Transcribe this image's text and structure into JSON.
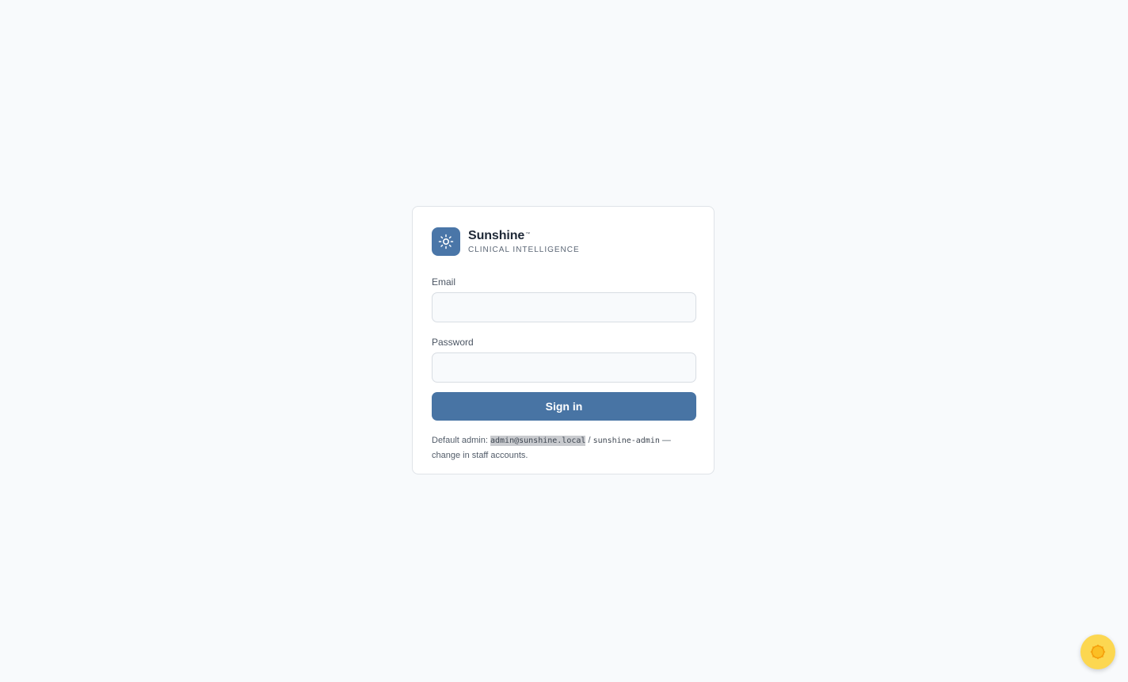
{
  "brand": {
    "logo_icon": "sun-icon",
    "name": "Sunshine",
    "trademark": "™",
    "tagline": "CLINICAL INTELLIGENCE"
  },
  "form": {
    "email_label": "Email",
    "email_value": "",
    "password_label": "Password",
    "password_value": "",
    "submit_label": "Sign in"
  },
  "hint": {
    "prefix": "Default admin: ",
    "email": "admin@sunshine.local",
    "separator": " / ",
    "password": "sunshine-admin",
    "suffix": " — change in staff accounts."
  },
  "theme_toggle": {
    "icon": "sun-icon"
  },
  "colors": {
    "accent": "#4874a4",
    "page_background": "#f8fafc",
    "toggle": "#fcd751"
  }
}
